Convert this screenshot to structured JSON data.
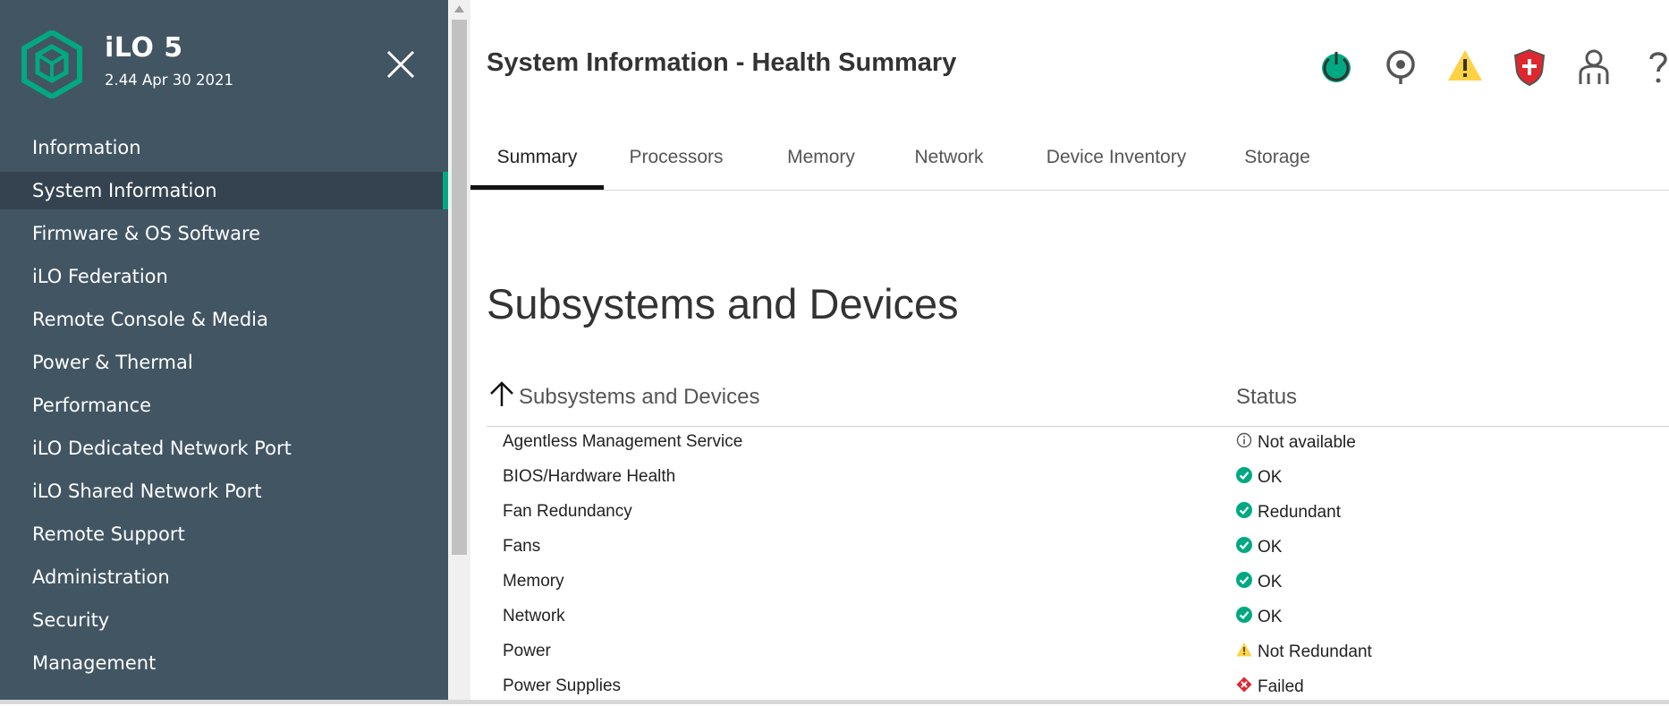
{
  "app": {
    "name": "iLO 5",
    "version": "2.44 Apr 30 2021"
  },
  "sidebar": {
    "items": [
      {
        "label": "Information"
      },
      {
        "label": "System Information",
        "active": true
      },
      {
        "label": "Firmware & OS Software"
      },
      {
        "label": "iLO Federation"
      },
      {
        "label": "Remote Console & Media"
      },
      {
        "label": "Power & Thermal"
      },
      {
        "label": "Performance"
      },
      {
        "label": "iLO Dedicated Network Port"
      },
      {
        "label": "iLO Shared Network Port"
      },
      {
        "label": "Remote Support"
      },
      {
        "label": "Administration"
      },
      {
        "label": "Security"
      },
      {
        "label": "Management"
      }
    ]
  },
  "header": {
    "title": "System Information - Health Summary",
    "icons": [
      "power-icon",
      "locator-icon",
      "warning-icon",
      "security-shield-icon",
      "user-icon",
      "help-icon"
    ]
  },
  "tabs": [
    {
      "label": "Summary",
      "active": true
    },
    {
      "label": "Processors"
    },
    {
      "label": "Memory"
    },
    {
      "label": "Network"
    },
    {
      "label": "Device Inventory"
    },
    {
      "label": "Storage"
    }
  ],
  "section": {
    "title": "Subsystems and Devices",
    "columns": {
      "name": "Subsystems and Devices",
      "status": "Status"
    },
    "rows": [
      {
        "name": "Agentless Management Service",
        "status": "Not available",
        "icon": "info-icon"
      },
      {
        "name": "BIOS/Hardware Health",
        "status": "OK",
        "icon": "ok-icon"
      },
      {
        "name": "Fan Redundancy",
        "status": "Redundant",
        "icon": "ok-icon"
      },
      {
        "name": "Fans",
        "status": "OK",
        "icon": "ok-icon"
      },
      {
        "name": "Memory",
        "status": "OK",
        "icon": "ok-icon"
      },
      {
        "name": "Network",
        "status": "OK",
        "icon": "ok-icon"
      },
      {
        "name": "Power",
        "status": "Not Redundant",
        "icon": "warning-icon"
      },
      {
        "name": "Power Supplies",
        "status": "Failed",
        "icon": "critical-icon"
      }
    ]
  },
  "colors": {
    "sidebar_bg": "#425563",
    "sidebar_active": "#354350",
    "accent": "#01a982",
    "warning": "#ffd144",
    "critical": "#e0262e"
  }
}
